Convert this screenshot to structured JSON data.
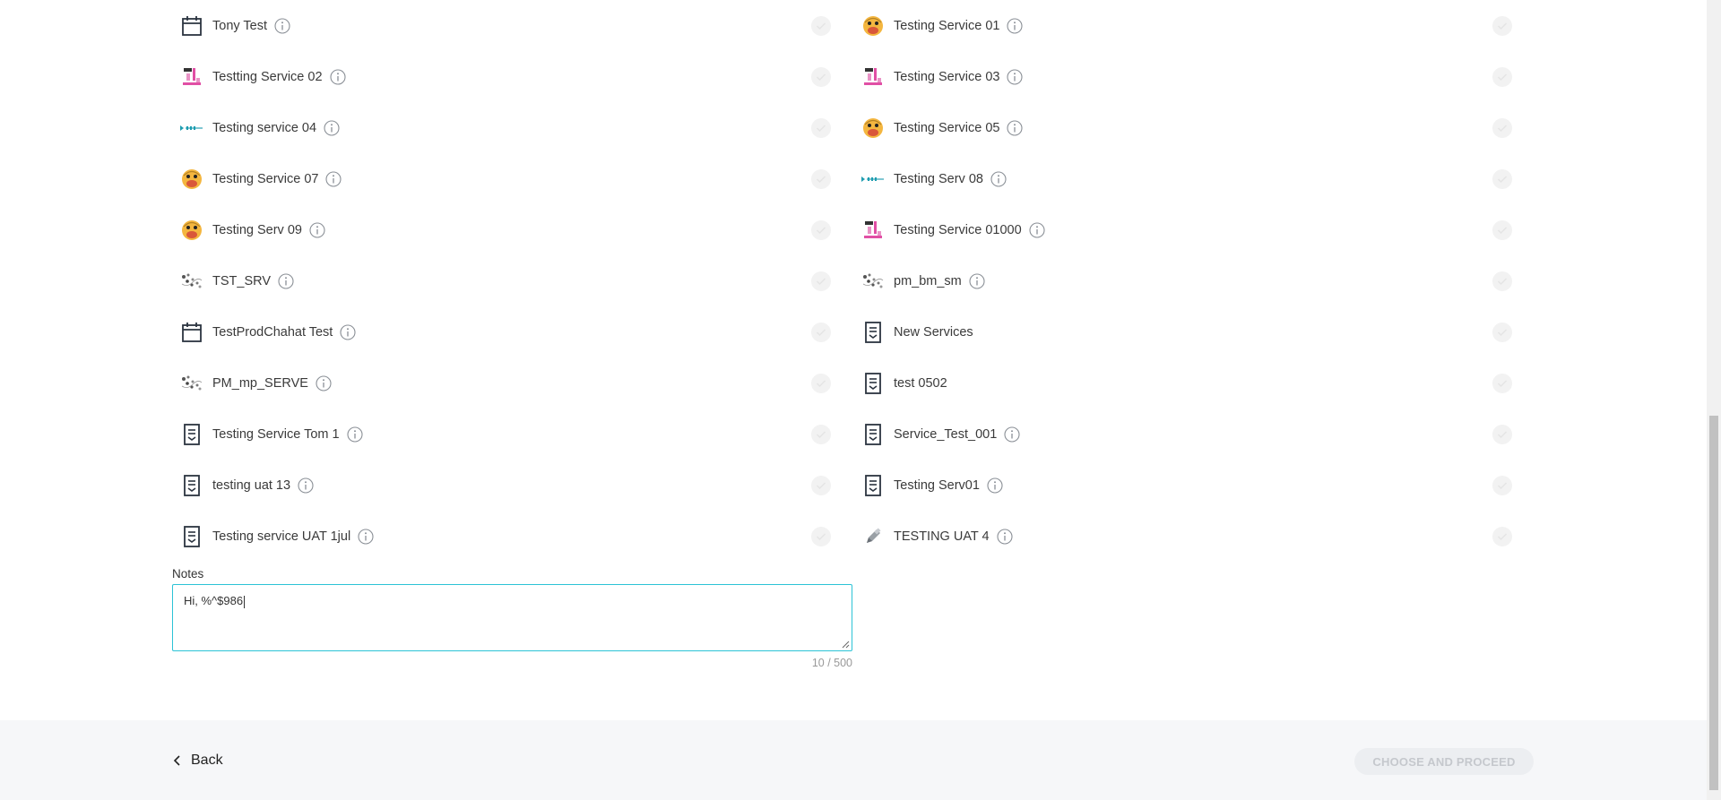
{
  "services": {
    "left": [
      {
        "name": "Tony Test",
        "icon": "calendar-icon",
        "has_info": true
      },
      {
        "name": "Testting Service 02",
        "icon": "pink-equipment-icon",
        "has_info": true
      },
      {
        "name": "Testing service 04",
        "icon": "teal-logo-icon",
        "has_info": true
      },
      {
        "name": "Testing Service 07",
        "icon": "duck-avatar-icon",
        "has_info": true
      },
      {
        "name": "Testing Serv 09",
        "icon": "duck-avatar-icon",
        "has_info": true
      },
      {
        "name": "TST_SRV",
        "icon": "dots-graphic-icon",
        "has_info": true
      },
      {
        "name": "TestProdChahat Test",
        "icon": "calendar-icon",
        "has_info": true
      },
      {
        "name": "PM_mp_SERVE",
        "icon": "dots-graphic-icon",
        "has_info": true
      },
      {
        "name": "Testing Service Tom 1",
        "icon": "document-icon",
        "has_info": true
      },
      {
        "name": "testing uat 13",
        "icon": "document-icon",
        "has_info": true
      },
      {
        "name": "Testing service UAT 1jul",
        "icon": "document-icon",
        "has_info": true
      }
    ],
    "right": [
      {
        "name": "Testing Service 01",
        "icon": "duck-avatar-icon",
        "has_info": true
      },
      {
        "name": "Testing Service 03",
        "icon": "pink-equipment-icon",
        "has_info": true
      },
      {
        "name": "Testing Service 05",
        "icon": "duck-avatar-icon",
        "has_info": true
      },
      {
        "name": "Testing Serv 08",
        "icon": "teal-logo-icon",
        "has_info": true
      },
      {
        "name": "Testing Service 01000",
        "icon": "pink-equipment-icon",
        "has_info": true
      },
      {
        "name": "pm_bm_sm",
        "icon": "dots-graphic-icon",
        "has_info": true
      },
      {
        "name": "New Services",
        "icon": "document-icon",
        "has_info": false
      },
      {
        "name": "test 0502",
        "icon": "document-icon",
        "has_info": false
      },
      {
        "name": "Service_Test_001",
        "icon": "document-icon",
        "has_info": true
      },
      {
        "name": "Testing Serv01",
        "icon": "document-icon",
        "has_info": true
      },
      {
        "name": "TESTING UAT 4",
        "icon": "pencil-icon",
        "has_info": true
      }
    ]
  },
  "notes": {
    "label": "Notes",
    "value": "Hi, %^$986",
    "char_count": "10 / 500"
  },
  "footer": {
    "back_label": "Back",
    "proceed_label": "CHOOSE AND PROCEED"
  },
  "colors": {
    "focus_border": "#2cc3d6",
    "footer_bg": "#f6f7f9",
    "disabled_button_bg": "#eceef1",
    "disabled_button_text": "#c5c8cd"
  }
}
